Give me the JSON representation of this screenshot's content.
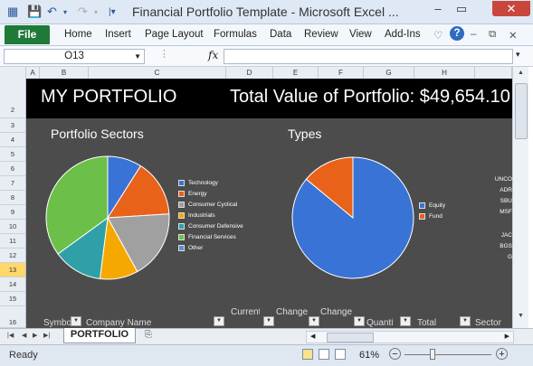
{
  "window": {
    "title": "Financial Portfolio Template - Microsoft Excel ...",
    "quick_access": [
      "save-icon",
      "undo-icon",
      "redo-icon",
      "customize-icon"
    ]
  },
  "ribbon": {
    "file_label": "File",
    "tabs": [
      "Home",
      "Insert",
      "Page Layout",
      "Formulas",
      "Data",
      "Review",
      "View",
      "Add-Ins"
    ]
  },
  "formula_bar": {
    "name_box": "O13",
    "fx": "fx",
    "value": ""
  },
  "columns": [
    "A",
    "B",
    "C",
    "D",
    "E",
    "F",
    "G",
    "H"
  ],
  "rows": [
    "2",
    "3",
    "4",
    "5",
    "6",
    "7",
    "8",
    "9",
    "10",
    "11",
    "12",
    "13",
    "14",
    "15",
    "16"
  ],
  "selected_row": "13",
  "dashboard": {
    "title": "MY PORTFOLIO",
    "total_value": "Total Value of Portfolio: $49,654.10",
    "sectors_title": "Portfolio Sectors",
    "types_title": "Types",
    "clipped_tickers": [
      "UNCO",
      "ADR",
      "SBU",
      "MSF",
      "JAC",
      "BGS",
      "G"
    ],
    "table_headers": [
      "Symbol",
      "Company Name",
      "Current Price",
      "Change in Price",
      "Change in Price",
      "Quantity",
      "Total",
      "Sector"
    ]
  },
  "chart_data": [
    {
      "type": "pie",
      "title": "Portfolio Sectors",
      "categories": [
        "Technology",
        "Energy",
        "Consumer Cyclical",
        "Industrials",
        "Consumer Defensive",
        "Financial Services",
        "Other"
      ],
      "values": [
        9,
        15,
        18,
        10,
        13,
        35,
        0
      ],
      "colors": [
        "#3a73d6",
        "#e8621a",
        "#a0a0a0",
        "#f5a800",
        "#2fa0a8",
        "#6cc04a",
        "#5b8fd0"
      ],
      "legend_position": "right"
    },
    {
      "type": "pie",
      "title": "Types",
      "categories": [
        "Equity",
        "Fund"
      ],
      "values": [
        86,
        14
      ],
      "colors": [
        "#3a73d6",
        "#e8621a"
      ],
      "legend_position": "right"
    }
  ],
  "sheet": {
    "tab": "PORTFOLIO"
  },
  "status": {
    "ready": "Ready",
    "zoom": "61%"
  }
}
